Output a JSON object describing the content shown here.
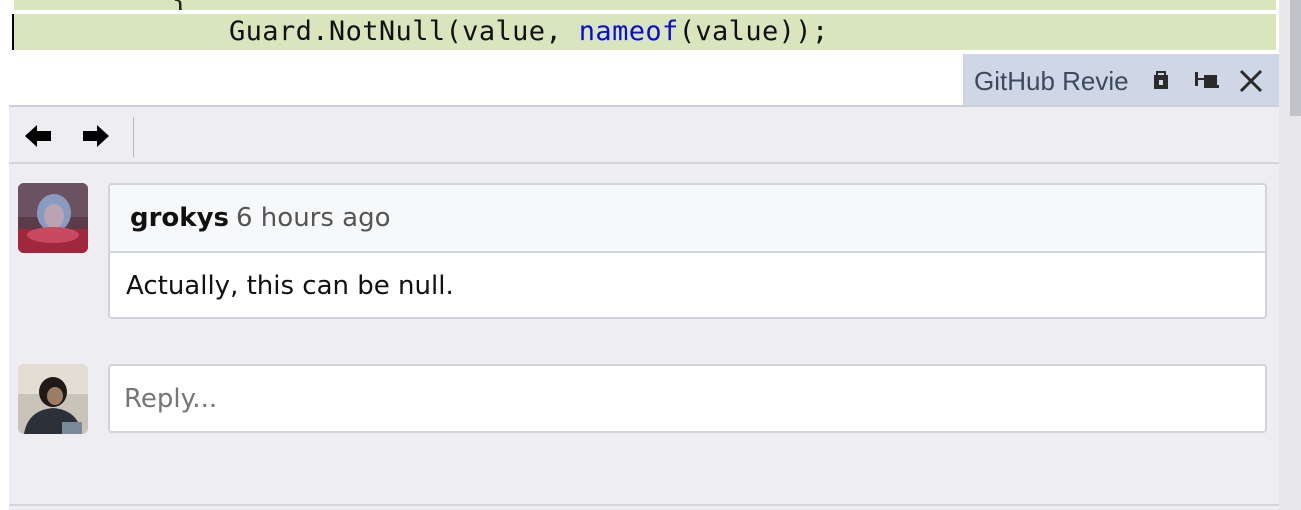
{
  "editor": {
    "code_line_prefix": "Guard.NotNull(value, ",
    "code_line_keyword": "nameof",
    "code_line_suffix": "(value));",
    "top_strip_text": "{"
  },
  "tool_window": {
    "title": "GitHub Revie",
    "buttons": [
      "window-position-icon",
      "pin-icon",
      "close-icon"
    ]
  },
  "toolbar": {
    "back_icon": "arrow-left-icon",
    "forward_icon": "arrow-right-icon"
  },
  "comments": [
    {
      "author": "grokys",
      "time": "6 hours ago",
      "body": "Actually, this can be null."
    }
  ],
  "reply": {
    "placeholder": "Reply..."
  },
  "colors": {
    "code_highlight": "#d9e5bd",
    "keyword": "#0b0bd8",
    "tab_background": "#cfd6e5",
    "panel_background": "#eeeef2"
  }
}
